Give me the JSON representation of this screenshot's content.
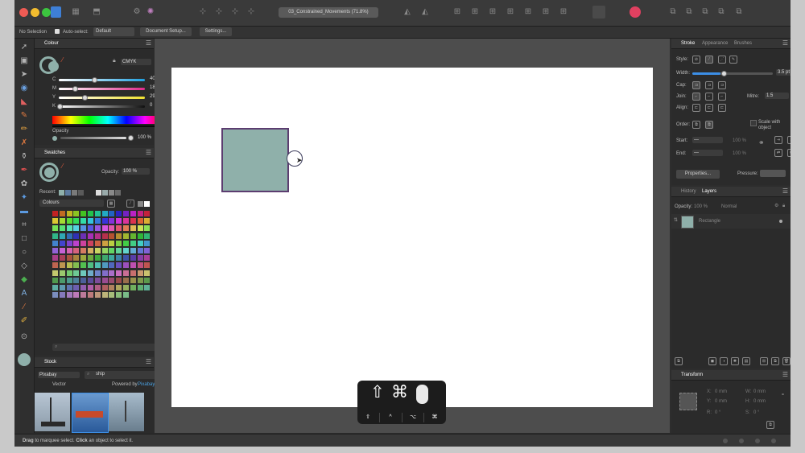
{
  "window": {
    "document_title": "03_Constrained_Movements (71.8%)"
  },
  "context": {
    "no_selection": "No Selection",
    "auto_select_label": "Auto-select:",
    "auto_select_value": "Default",
    "document_setup": "Document Setup...",
    "settings": "Settings..."
  },
  "colour_panel": {
    "title": "Colour",
    "model": "CMYK",
    "channels": [
      {
        "name": "C",
        "value": "40"
      },
      {
        "name": "M",
        "value": "18"
      },
      {
        "name": "Y",
        "value": "29"
      },
      {
        "name": "K",
        "value": "0"
      }
    ],
    "opacity_label": "Opacity",
    "opacity_value": "100 %"
  },
  "swatches_panel": {
    "title": "Swatches",
    "opacity_label": "Opacity:",
    "opacity_value": "100 %",
    "recent_label": "Recent:",
    "palette_name": "Colours",
    "search_placeholder": ""
  },
  "stock_panel": {
    "title": "Stock",
    "source": "Pixabay",
    "query": "ship",
    "vector_label": "Vector",
    "powered_by": "Powered by",
    "powered_brand": "Pixabay"
  },
  "stroke_panel": {
    "tabs": [
      "Stroke",
      "Appearance",
      "Brushes"
    ],
    "style_label": "Style:",
    "width_label": "Width:",
    "width_value": "3.5 pt",
    "width_fraction": 0.35,
    "cap_label": "Cap:",
    "join_label": "Join:",
    "mitre_label": "Mitre:",
    "mitre_value": "1.5",
    "align_label": "Align:",
    "order_label": "Order:",
    "scale_with_object": "Scale with object",
    "start_label": "Start:",
    "end_label": "End:",
    "start_pct": "100 %",
    "end_pct": "100 %",
    "properties_button": "Properties...",
    "pressure_label": "Pressure:"
  },
  "layers_panel": {
    "tabs": [
      "History",
      "Layers"
    ],
    "opacity_label": "Opacity:",
    "opacity_value": "100 %",
    "blend_mode": "Normal",
    "layer_name": "Rectangle"
  },
  "transform_panel": {
    "title": "Transform",
    "x_label": "X:",
    "x_value": "0 mm",
    "y_label": "Y:",
    "y_value": "0 mm",
    "w_label": "W:",
    "w_value": "0 mm",
    "h_label": "H:",
    "h_value": "0 mm",
    "r_label": "R:",
    "r_value": "0 °",
    "s_label": "S:",
    "s_value": "0 °"
  },
  "keys_overlay": {
    "glyphs": [
      "⇧",
      "⌘"
    ],
    "modifiers": [
      "⇧",
      "^",
      "⌥",
      "⌘"
    ]
  },
  "status": {
    "drag": "Drag",
    "text1": " to marquee select. ",
    "click": "Click",
    "text2": " an object to select it."
  },
  "colors": {
    "rect_fill": "#8fb0aa",
    "rect_stroke": "#5c3d70",
    "accent_blue": "#3c8ee6"
  }
}
